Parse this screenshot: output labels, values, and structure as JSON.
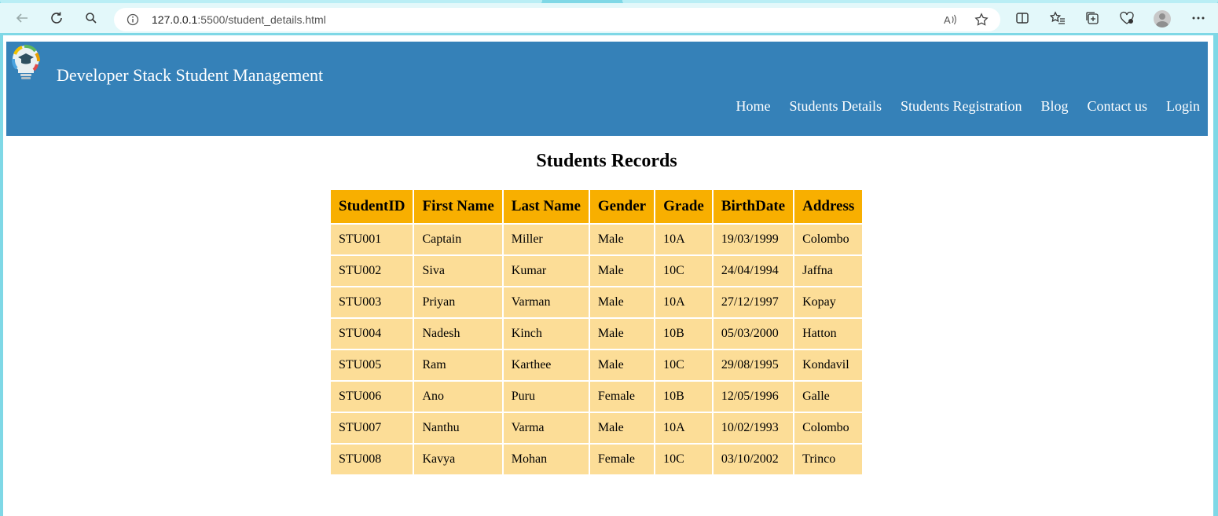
{
  "browser": {
    "url_host": "127.0.0.1",
    "url_rest": ":5500/student_details.html"
  },
  "site": {
    "title": "Developer Stack Student Management",
    "nav": [
      "Home",
      "Students Details",
      "Students Registration",
      "Blog",
      "Contact us",
      "Login"
    ]
  },
  "main": {
    "heading": "Students Records",
    "table": {
      "headers": [
        "StudentID",
        "First Name",
        "Last Name",
        "Gender",
        "Grade",
        "BirthDate",
        "Address"
      ],
      "rows": [
        [
          "STU001",
          "Captain",
          "Miller",
          "Male",
          "10A",
          "19/03/1999",
          "Colombo"
        ],
        [
          "STU002",
          "Siva",
          "Kumar",
          "Male",
          "10C",
          "24/04/1994",
          "Jaffna"
        ],
        [
          "STU003",
          "Priyan",
          "Varman",
          "Male",
          "10A",
          "27/12/1997",
          "Kopay"
        ],
        [
          "STU004",
          "Nadesh",
          "Kinch",
          "Male",
          "10B",
          "05/03/2000",
          "Hatton"
        ],
        [
          "STU005",
          "Ram",
          "Karthee",
          "Male",
          "10C",
          "29/08/1995",
          "Kondavil"
        ],
        [
          "STU006",
          "Ano",
          "Puru",
          "Female",
          "10B",
          "12/05/1996",
          "Galle"
        ],
        [
          "STU007",
          "Nanthu",
          "Varma",
          "Male",
          "10A",
          "10/02/1993",
          "Colombo"
        ],
        [
          "STU008",
          "Kavya",
          "Mohan",
          "Female",
          "10C",
          "03/10/2002",
          "Trinco"
        ]
      ]
    }
  },
  "colors": {
    "header_bg": "#3581b8",
    "table_head_bg": "#f8af00",
    "table_cell_bg": "#fcdd97"
  }
}
